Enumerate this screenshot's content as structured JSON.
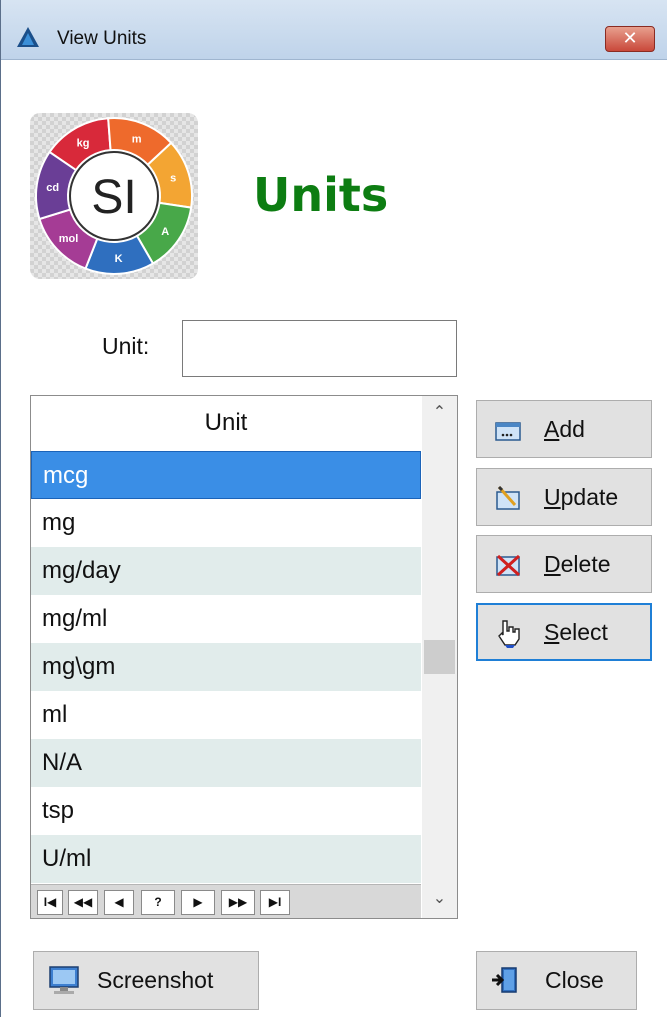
{
  "window": {
    "title": "View Units",
    "close_glyph": "✕"
  },
  "heading": "Units",
  "logo": {
    "center_text": "SI",
    "segments": [
      {
        "label": "kg",
        "color": "#d8293a"
      },
      {
        "label": "m",
        "color": "#ee6a2c"
      },
      {
        "label": "s",
        "color": "#f3a533"
      },
      {
        "label": "A",
        "color": "#48a849"
      },
      {
        "label": "K",
        "color": "#2f6fbf"
      },
      {
        "label": "mol",
        "color": "#a53c95"
      },
      {
        "label": "cd",
        "color": "#6a3e96"
      }
    ]
  },
  "unit_field": {
    "label": "Unit:",
    "value": ""
  },
  "list": {
    "header": "Unit",
    "rows": [
      {
        "text": "mcg",
        "state": "selected"
      },
      {
        "text": "mg",
        "state": "normal"
      },
      {
        "text": "mg/day",
        "state": "alt"
      },
      {
        "text": "mg/ml",
        "state": "normal"
      },
      {
        "text": "mg\\gm",
        "state": "alt"
      },
      {
        "text": "ml",
        "state": "normal"
      },
      {
        "text": "N/A",
        "state": "alt"
      },
      {
        "text": "tsp",
        "state": "normal"
      },
      {
        "text": "U/ml",
        "state": "alt"
      }
    ],
    "nav": [
      "⏮",
      "⏪",
      "◀",
      "?",
      "▶",
      "⏩",
      "⏭"
    ],
    "nav_text": [
      "I◀",
      "◀◀",
      "◀",
      "?",
      "▶",
      "▶▶",
      "▶I"
    ]
  },
  "buttons": {
    "add": {
      "first": "A",
      "rest": "dd"
    },
    "update": {
      "first": "U",
      "rest": "pdate"
    },
    "delete": {
      "first": "D",
      "rest": "elete"
    },
    "select": {
      "first": "S",
      "rest": "elect"
    },
    "screenshot": "Screenshot",
    "close": "Close"
  },
  "colors": {
    "heading": "#0d7d12",
    "selection": "#3a8ee6",
    "alt_row": "#e1eceb",
    "focus": "#1f7fd6"
  }
}
